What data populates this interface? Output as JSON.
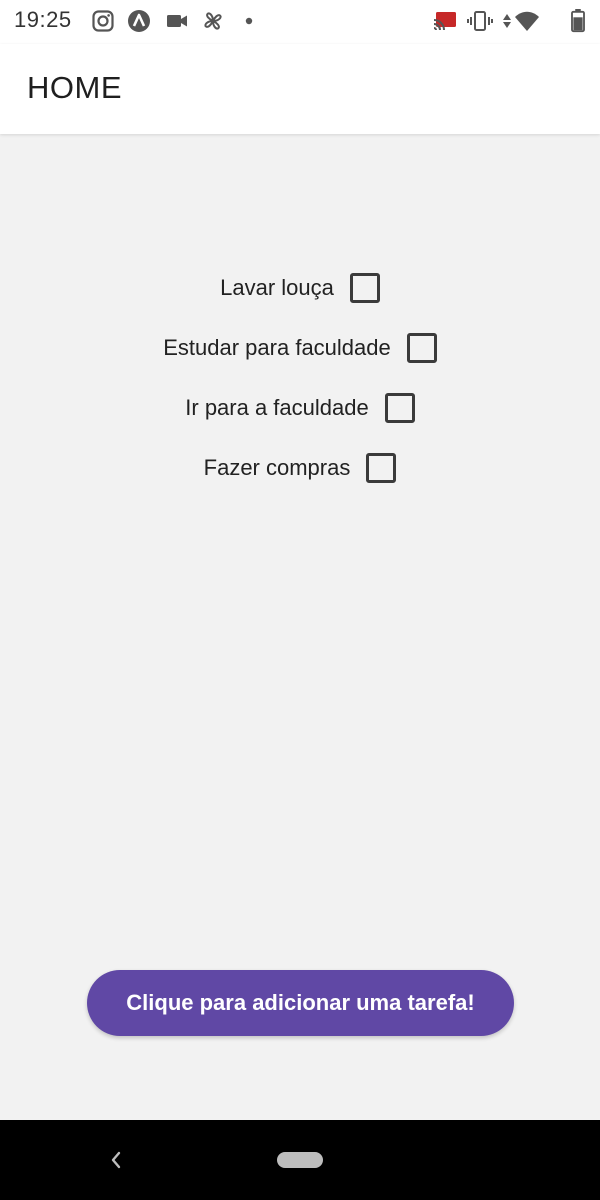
{
  "status_bar": {
    "time": "19:25",
    "icons": [
      "instagram-icon",
      "app-icon",
      "video-icon",
      "pinwheel-icon",
      "dot-icon",
      "cast-icon",
      "vibrate-icon",
      "data-arrows-icon",
      "wifi-icon",
      "battery-icon"
    ]
  },
  "app_bar": {
    "title": "HOME"
  },
  "tasks": [
    {
      "label": "Lavar louça",
      "checked": false
    },
    {
      "label": "Estudar para faculdade",
      "checked": false
    },
    {
      "label": "Ir para a faculdade",
      "checked": false
    },
    {
      "label": "Fazer compras",
      "checked": false
    }
  ],
  "add_button": {
    "label": "Clique para adicionar uma tarefa!"
  },
  "nav_bar": {
    "icons": [
      "back-icon",
      "home-pill-icon"
    ]
  },
  "colors": {
    "accent": "#6048a5",
    "background": "#f2f2f2",
    "app_bar": "#ffffff",
    "nav_bar": "#000000"
  }
}
